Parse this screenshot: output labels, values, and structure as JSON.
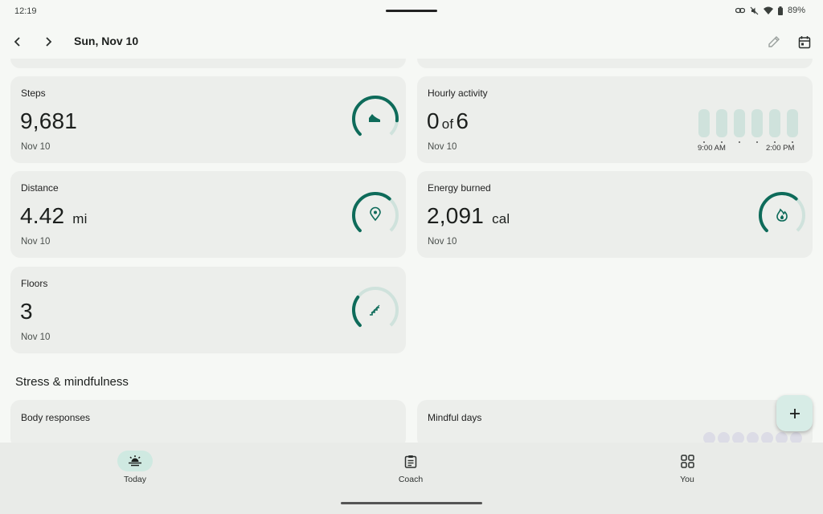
{
  "status_bar": {
    "time": "12:19",
    "battery": "89%",
    "icons": [
      "link-icon",
      "mute-icon",
      "wifi-icon",
      "battery-icon"
    ]
  },
  "header": {
    "date": "Sun, Nov 10",
    "icons": [
      "back-icon",
      "forward-icon",
      "edit-icon",
      "calendar-icon"
    ]
  },
  "cards": {
    "steps": {
      "label": "Steps",
      "value": "9,681",
      "date": "Nov 10",
      "icon": "shoe-icon",
      "progress": 0.85
    },
    "hourly": {
      "label": "Hourly activity",
      "value_main": "0",
      "value_of": "of",
      "value_total": "6",
      "date": "Nov 10",
      "bars": 6,
      "start_label": "9:00 AM",
      "end_label": "2:00 PM"
    },
    "distance": {
      "label": "Distance",
      "value": "4.42",
      "unit": "mi",
      "date": "Nov 10",
      "icon": "location-pin-icon",
      "progress": 0.65
    },
    "energy": {
      "label": "Energy burned",
      "value": "2,091",
      "unit": "cal",
      "date": "Nov 10",
      "icon": "flame-icon",
      "progress": 0.65
    },
    "floors": {
      "label": "Floors",
      "value": "3",
      "date": "Nov 10",
      "icon": "stairs-icon",
      "progress": 0.3
    }
  },
  "sections": {
    "stress_title": "Stress & mindfulness",
    "body_responses_label": "Body responses",
    "mindful_days_label": "Mindful days"
  },
  "colors": {
    "accent": "#0e6b5a",
    "track": "#cfe2dc",
    "card": "#eceeeb"
  },
  "bottom_nav": {
    "items": [
      {
        "label": "Today",
        "icon": "sun-horizon-icon",
        "active": true
      },
      {
        "label": "Coach",
        "icon": "clipboard-icon",
        "active": false
      },
      {
        "label": "You",
        "icon": "grid-icon",
        "active": false
      }
    ]
  }
}
